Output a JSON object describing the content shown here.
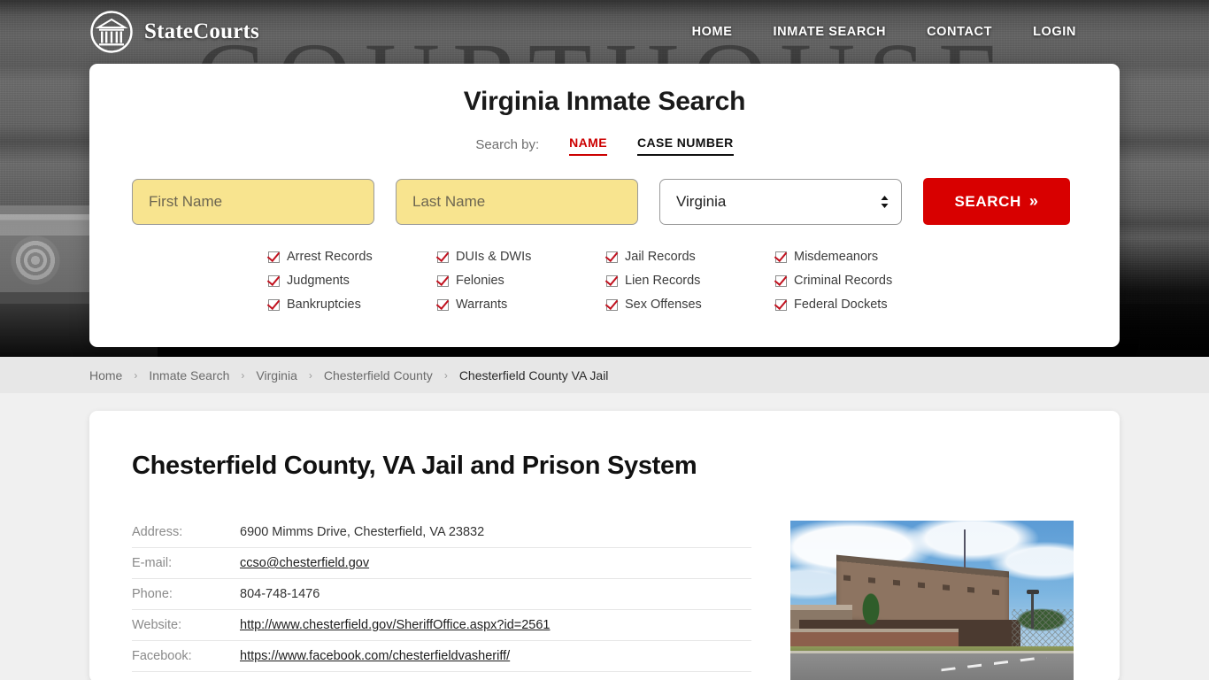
{
  "header": {
    "brand": "StateCourts",
    "logo_icon": "courthouse-circle-logo",
    "background_word": "COURTHOUSE",
    "nav": [
      {
        "label": "HOME"
      },
      {
        "label": "INMATE SEARCH"
      },
      {
        "label": "CONTACT"
      },
      {
        "label": "LOGIN"
      }
    ]
  },
  "search_card": {
    "title": "Virginia Inmate Search",
    "search_by_label": "Search by:",
    "tabs": [
      {
        "label": "NAME",
        "active": true
      },
      {
        "label": "CASE NUMBER",
        "active": false
      }
    ],
    "first_name_placeholder": "First Name",
    "first_name_value": "",
    "last_name_placeholder": "Last Name",
    "last_name_value": "",
    "state_value": "Virginia",
    "state_options": [
      "Virginia"
    ],
    "search_button": "SEARCH",
    "search_button_chevron": "»",
    "accent_red": "#d80000",
    "field_yellow": "#f8e48f",
    "record_types": [
      "Arrest Records",
      "DUIs & DWIs",
      "Jail Records",
      "Misdemeanors",
      "Judgments",
      "Felonies",
      "Lien Records",
      "Criminal Records",
      "Bankruptcies",
      "Warrants",
      "Sex Offenses",
      "Federal Dockets"
    ]
  },
  "breadcrumb": {
    "separator": "›",
    "items": [
      {
        "label": "Home",
        "current": false
      },
      {
        "label": "Inmate Search",
        "current": false
      },
      {
        "label": "Virginia",
        "current": false
      },
      {
        "label": "Chesterfield County",
        "current": false
      },
      {
        "label": "Chesterfield County VA Jail",
        "current": true
      }
    ]
  },
  "content": {
    "title": "Chesterfield County, VA Jail and Prison System",
    "info_rows": [
      {
        "label": "Address:",
        "value": "6900 Mimms Drive, Chesterfield, VA 23832",
        "link": false
      },
      {
        "label": "E-mail:",
        "value": "ccso@chesterfield.gov",
        "link": true
      },
      {
        "label": "Phone:",
        "value": "804-748-1476",
        "link": false
      },
      {
        "label": "Website:",
        "value": "http://www.chesterfield.gov/SheriffOffice.aspx?id=2561",
        "link": true
      },
      {
        "label": "Facebook:",
        "value": "https://www.facebook.com/chesterfieldvasheriff/",
        "link": true
      }
    ],
    "photo_alt": "chesterfield-county-jail-building-photo"
  }
}
